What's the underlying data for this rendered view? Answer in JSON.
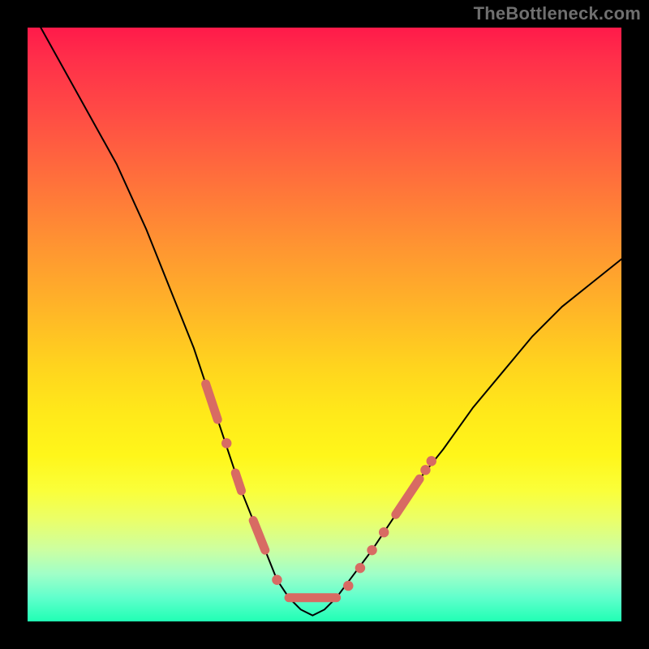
{
  "watermark": "TheBottleneck.com",
  "colors": {
    "frame": "#000000",
    "curve_stroke": "#000000",
    "marker_fill": "#d86b63",
    "gradient_top": "#ff1a4a",
    "gradient_bottom": "#20ffb4"
  },
  "chart_data": {
    "type": "line",
    "title": "",
    "xlabel": "",
    "ylabel": "",
    "xlim": [
      0,
      100
    ],
    "ylim": [
      0,
      100
    ],
    "curve": {
      "x": [
        0,
        5,
        10,
        15,
        20,
        22,
        24,
        26,
        28,
        30,
        32,
        34,
        36,
        38,
        40,
        42,
        44,
        46,
        48,
        50,
        52,
        55,
        58,
        62,
        66,
        70,
        75,
        80,
        85,
        90,
        95,
        100
      ],
      "y": [
        104,
        95,
        86,
        77,
        66,
        61,
        56,
        51,
        46,
        40,
        34,
        28,
        22,
        17,
        12,
        7,
        4,
        2,
        1,
        2,
        4,
        8,
        12,
        18,
        24,
        29,
        36,
        42,
        48,
        53,
        57,
        61
      ]
    },
    "markers": {
      "segments": [
        {
          "x1": 30,
          "y1": 40,
          "x2": 32,
          "y2": 34
        },
        {
          "x1": 35,
          "y1": 25,
          "x2": 36,
          "y2": 22
        },
        {
          "x1": 38,
          "y1": 17,
          "x2": 40,
          "y2": 12
        },
        {
          "x1": 44,
          "y1": 4,
          "x2": 52,
          "y2": 4
        },
        {
          "x1": 62,
          "y1": 18,
          "x2": 66,
          "y2": 24
        }
      ],
      "dots": [
        {
          "x": 33.5,
          "y": 30
        },
        {
          "x": 42,
          "y": 7
        },
        {
          "x": 54,
          "y": 6
        },
        {
          "x": 56,
          "y": 9
        },
        {
          "x": 58,
          "y": 12
        },
        {
          "x": 60,
          "y": 15
        },
        {
          "x": 67,
          "y": 25.5
        },
        {
          "x": 68,
          "y": 27
        }
      ]
    }
  }
}
